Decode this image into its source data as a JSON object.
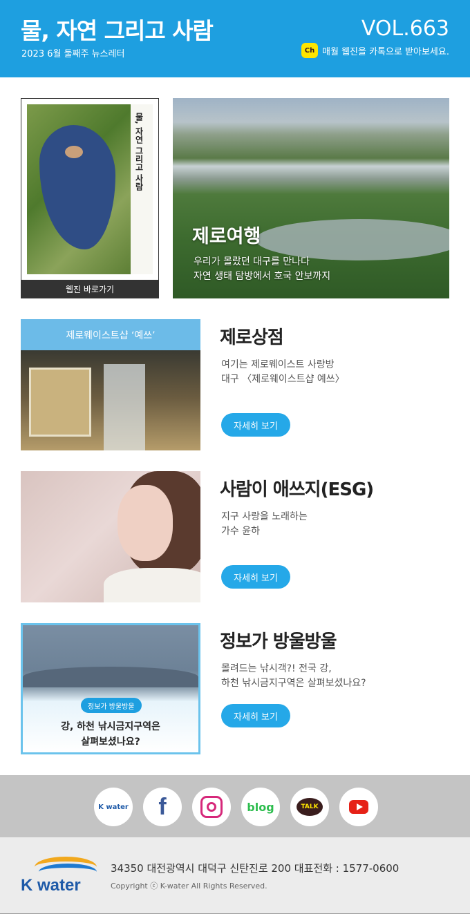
{
  "header": {
    "title": "물, 자연 그리고 사람",
    "subtitle": "2023 6월 둘째주 뉴스레터",
    "volume": "VOL.663",
    "kakao_badge": "Ch",
    "kakao_text": "매월 웹진을 카톡으로 받아보세요."
  },
  "cover": {
    "vertical_title": "물, 자연 그리고 사람",
    "button_label": "웹진 바로가기"
  },
  "hero": {
    "title": "제로여행",
    "line1": "우리가 몰랐던 대구를 만나다",
    "line2": "자연 생태 탐방에서 호국 안보까지"
  },
  "sections": [
    {
      "image_caption": "제로웨이스트샵 ‘예쓰’",
      "title": "제로상점",
      "desc1": "여기는 제로웨이스트 사랑방",
      "desc2": "대구 〈제로웨이스트샵 예쓰〉",
      "button": "자세히 보기"
    },
    {
      "title": "사람이 애쓰지(ESG)",
      "desc1": "지구 사랑을 노래하는",
      "desc2": "가수 윤하",
      "button": "자세히 보기"
    },
    {
      "image_pill": "정보가 방울방울",
      "image_caption1": "강, 하천 낚시금지구역은",
      "image_caption2": "살펴보셨나요?",
      "title": "정보가 방울방울",
      "desc1": "몰려드는 낚시객?! 전국 강,",
      "desc2": "하천 낚시금지구역은 살펴보셨나요?",
      "button": "자세히 보기"
    }
  ],
  "sns": {
    "kwater": "K water",
    "facebook": "f",
    "blog": "blog",
    "talk": "TALK"
  },
  "footer": {
    "logo_text": "K water",
    "address": "34350 대전광역시 대덕구 신탄진로 200   대표전화 : 1577-0600",
    "copyright": "Copyright ⓒ K-water All Rights Reserved."
  }
}
